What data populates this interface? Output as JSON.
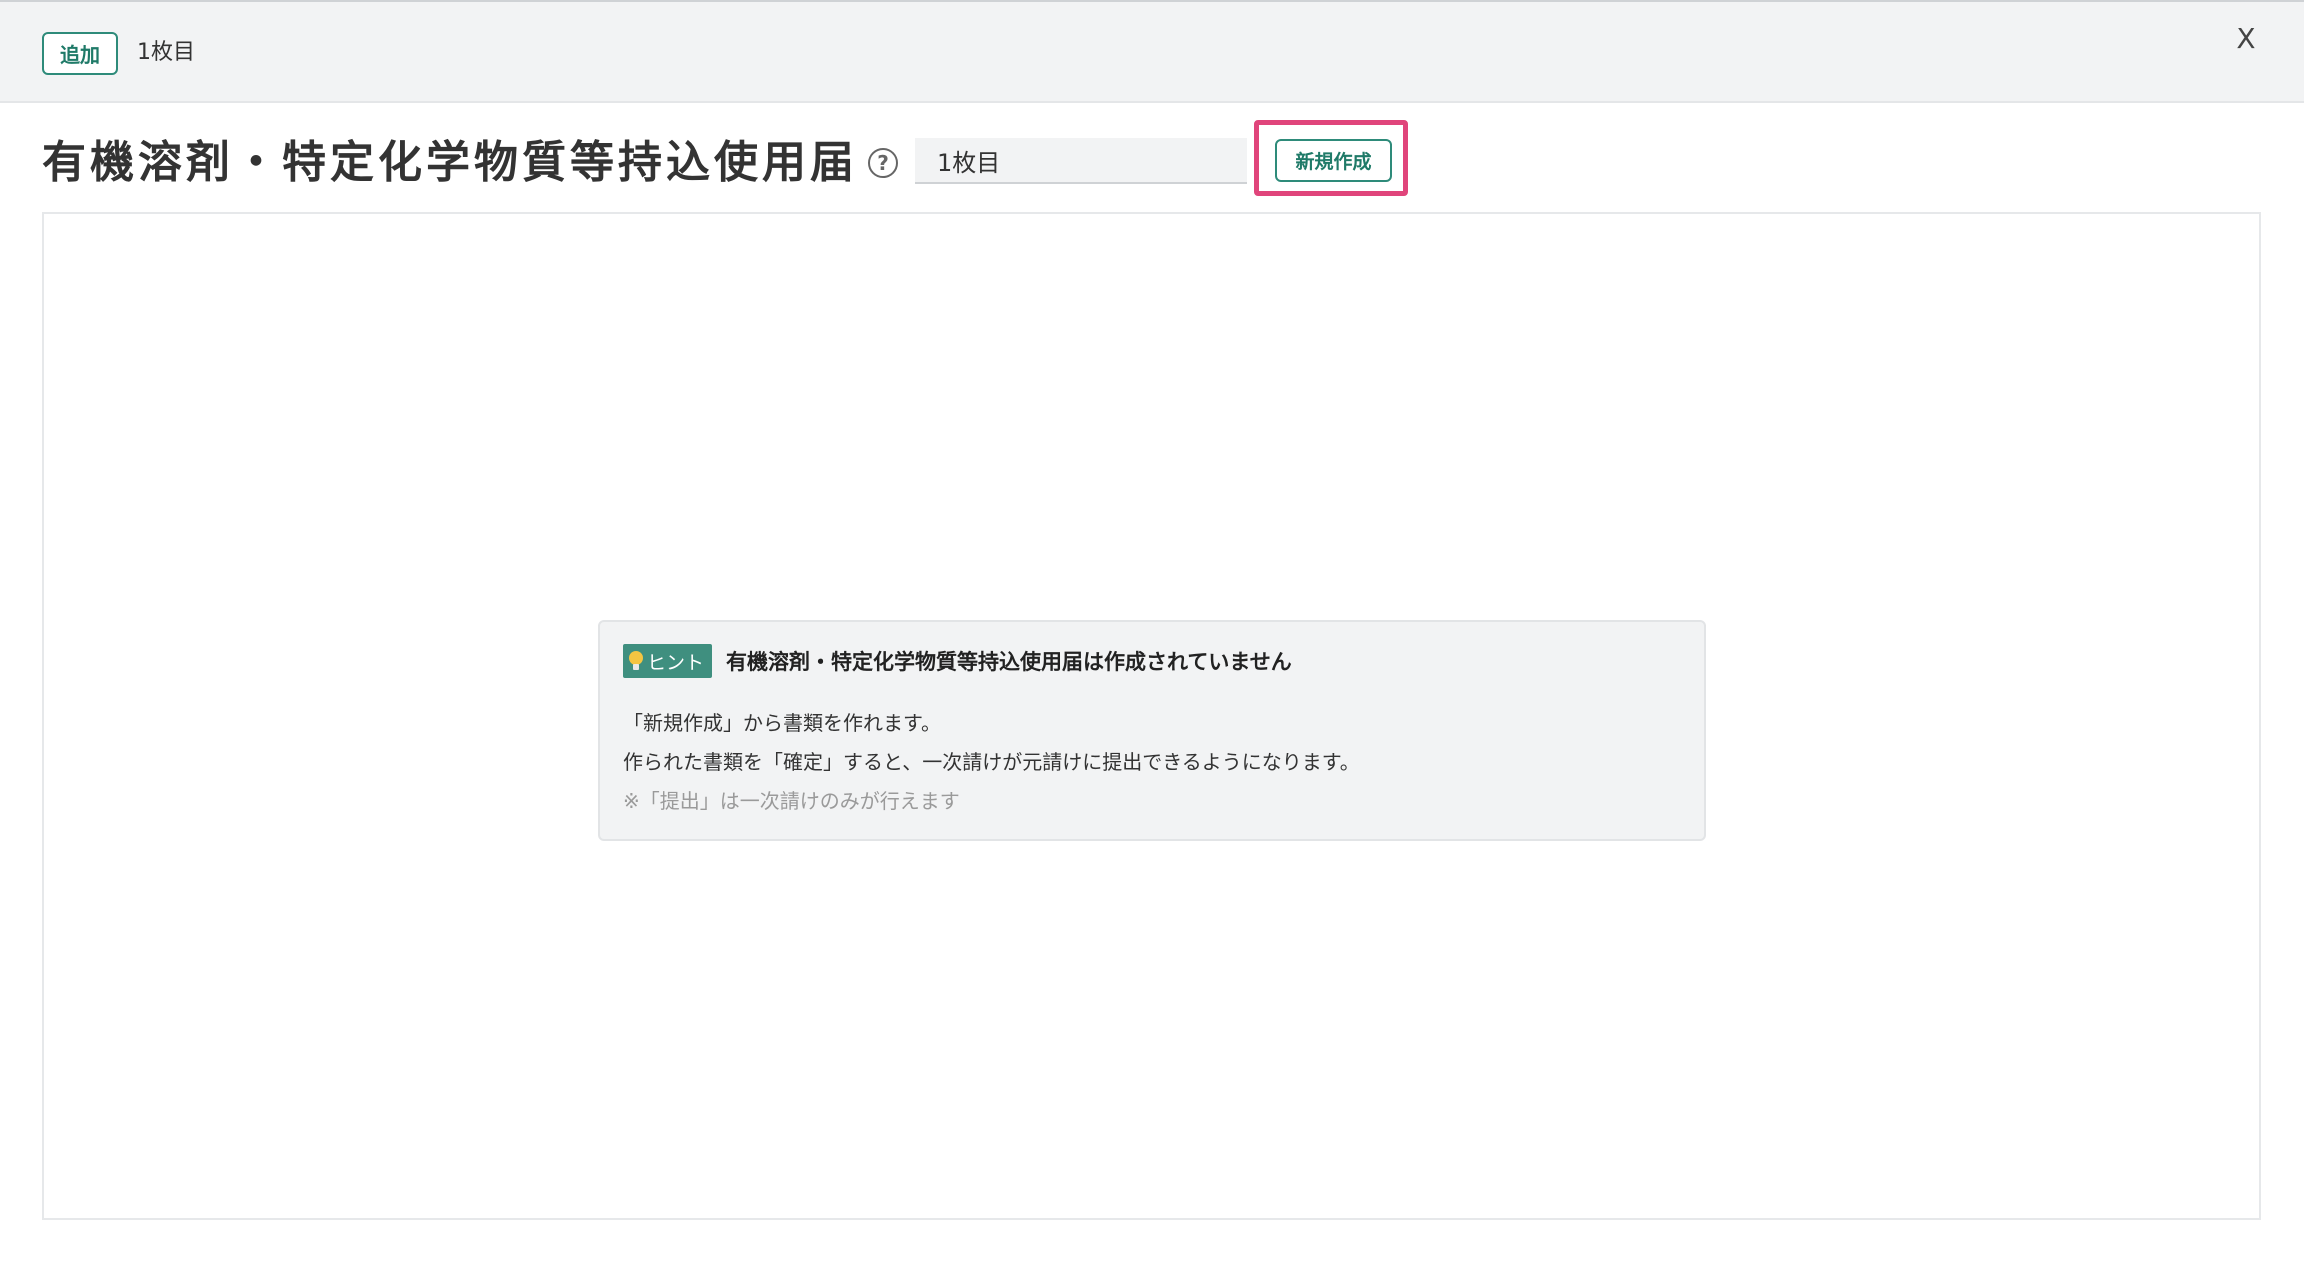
{
  "top_bar": {
    "add_label": "追加",
    "sheet_tab": "1枚目",
    "close_label": "X"
  },
  "header": {
    "title": "有機溶剤・特定化学物質等持込使用届",
    "help_icon": "question-circle-icon",
    "help_symbol": "?",
    "sheet_name_value": "1枚目",
    "new_button_label": "新規作成"
  },
  "hint": {
    "badge_label": "ヒント",
    "badge_icon": "lightbulb-icon",
    "title": "有機溶剤・特定化学物質等持込使用届は作成されていません",
    "line1": "「新規作成」から書類を作れます。",
    "line2": "作られた書類を「確定」すると、一次請けが元請けに提出できるようになります。",
    "note": "※「提出」は一次請けのみが行えます"
  },
  "colors": {
    "accent": "#2e8b7a",
    "badge": "#3f8f7f",
    "highlight": "#e0457b",
    "topbar": "#f2f3f4"
  }
}
